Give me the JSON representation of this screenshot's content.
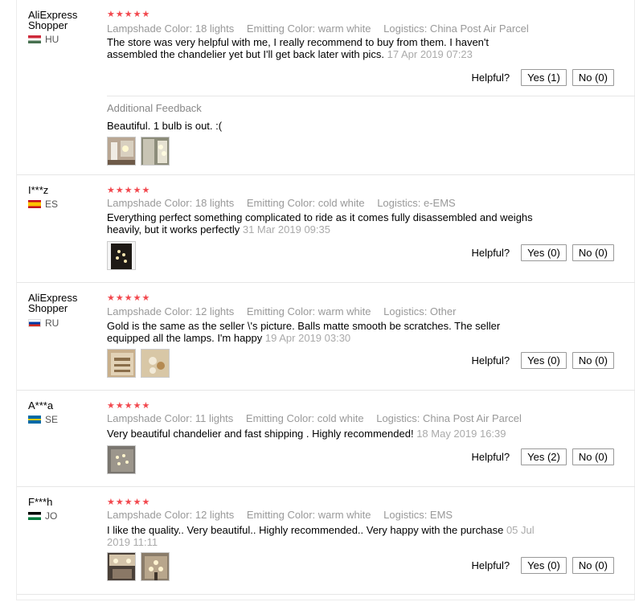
{
  "helpful_label": "Helpful?",
  "additional_feedback_label": "Additional Feedback",
  "reviews": [
    {
      "user": "AliExpress Shopper",
      "country": "HU",
      "stars": "★★★★★",
      "lampshade": "Lampshade Color: 18 lights",
      "emitting": "Emitting Color: warm white",
      "logistics": "Logistics: China Post Air Parcel",
      "text": "The store was very helpful with me, I really recommend to buy from them. I haven't assembled the chandelier yet but I'll get back later with pics.",
      "date": "17 Apr 2019 07:23",
      "yes": "Yes (1)",
      "no": "No (0)",
      "additional_text": "Beautiful. 1 bulb is out. :("
    },
    {
      "user": "I***z",
      "country": "ES",
      "stars": "★★★★★",
      "lampshade": "Lampshade Color: 18 lights",
      "emitting": "Emitting Color: cold white",
      "logistics": "Logistics: e-EMS",
      "text": "Everything perfect something complicated to ride as it comes fully disassembled and weighs heavily, but it works perfectly",
      "date": "31 Mar 2019 09:35",
      "yes": "Yes (0)",
      "no": "No (0)"
    },
    {
      "user": "AliExpress Shopper",
      "country": "RU",
      "stars": "★★★★★",
      "lampshade": "Lampshade Color: 12 lights",
      "emitting": "Emitting Color: warm white",
      "logistics": "Logistics: Other",
      "text": "Gold is the same as the seller \\'s picture. Balls matte smooth be scratches. The seller equipped all the lamps. I'm happy",
      "date": "19 Apr 2019 03:30",
      "yes": "Yes (0)",
      "no": "No (0)"
    },
    {
      "user": "A***a",
      "country": "SE",
      "stars": "★★★★★",
      "lampshade": "Lampshade Color: 11 lights",
      "emitting": "Emitting Color: cold white",
      "logistics": "Logistics: China Post Air Parcel",
      "text": "Very beautiful chandelier and fast shipping . Highly recommended!",
      "date": "18 May 2019 16:39",
      "yes": "Yes (2)",
      "no": "No (0)"
    },
    {
      "user": "F***h",
      "country": "JO",
      "stars": "★★★★★",
      "lampshade": "Lampshade Color: 12 lights",
      "emitting": "Emitting Color: warm white",
      "logistics": "Logistics: EMS",
      "text": "I like the quality.. Very beautiful.. Highly recommended.. Very happy with the purchase",
      "date": "05 Jul 2019 11:11",
      "yes": "Yes (0)",
      "no": "No (0)"
    }
  ]
}
